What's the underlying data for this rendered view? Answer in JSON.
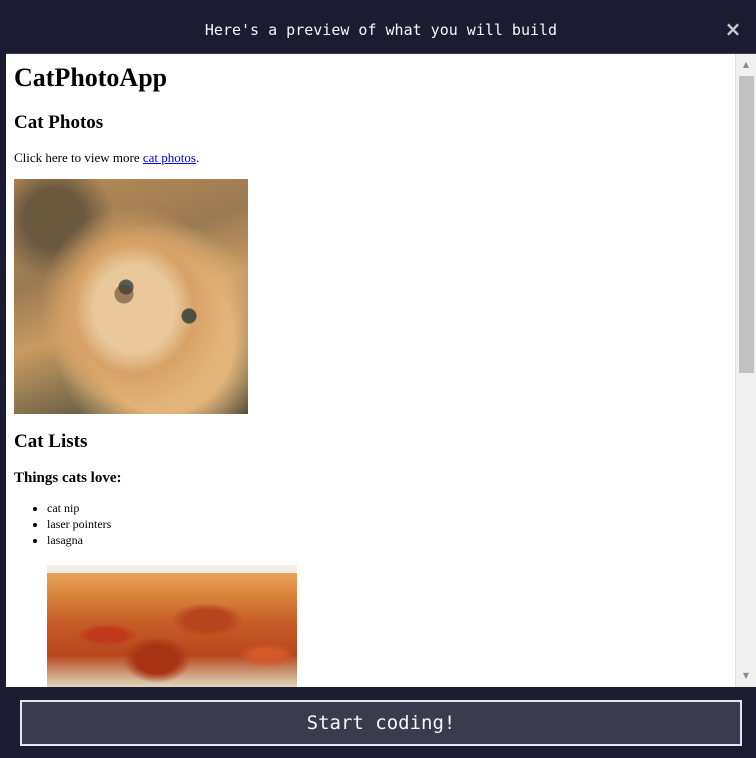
{
  "modal": {
    "title": "Here's a preview of what you will build",
    "close_label": "×",
    "start_button_label": "Start coding!"
  },
  "preview": {
    "app_title": "CatPhotoApp",
    "section_photos": "Cat Photos",
    "paragraph_prefix": "Click here to view more ",
    "paragraph_link": "cat photos",
    "paragraph_suffix": ".",
    "section_lists": "Cat Lists",
    "things_title": "Things cats love:",
    "love_items": [
      "cat nip",
      "laser pointers",
      "lasagna"
    ]
  },
  "scrollbar": {
    "up_arrow": "▲",
    "down_arrow": "▼"
  },
  "colors": {
    "modal_bg": "#1b1b32",
    "button_bg": "#3b3b4f",
    "link": "#0000ee"
  }
}
